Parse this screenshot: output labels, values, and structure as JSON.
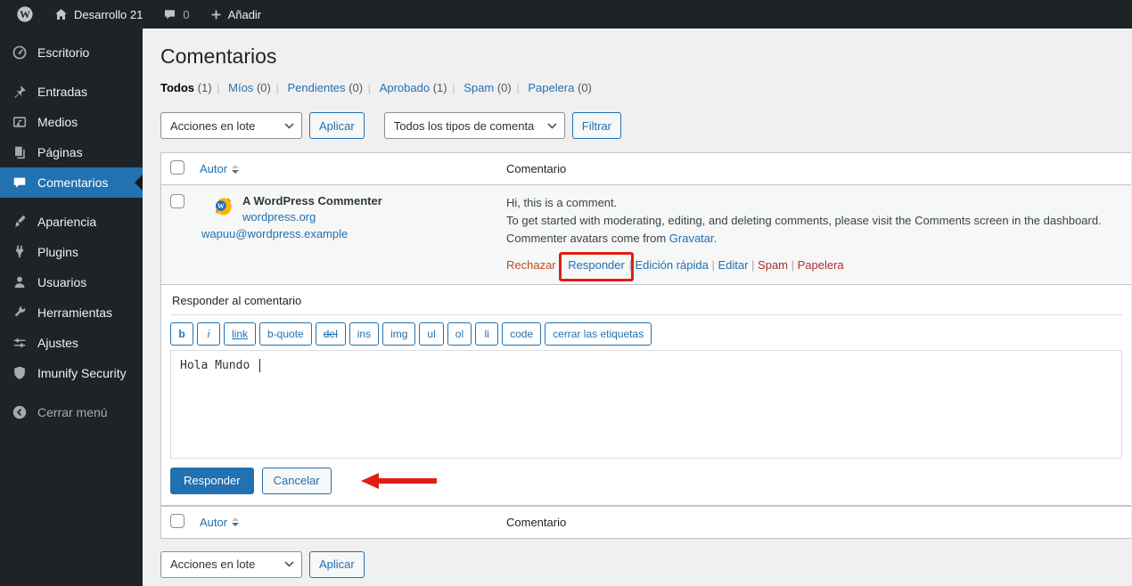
{
  "admin_bar": {
    "site_name": "Desarrollo 21",
    "comments_count": "0",
    "add_new_label": "Añadir"
  },
  "sidebar": {
    "items": [
      {
        "label": "Escritorio"
      },
      {
        "label": "Entradas"
      },
      {
        "label": "Medios"
      },
      {
        "label": "Páginas"
      },
      {
        "label": "Comentarios"
      },
      {
        "label": "Apariencia"
      },
      {
        "label": "Plugins"
      },
      {
        "label": "Usuarios"
      },
      {
        "label": "Herramientas"
      },
      {
        "label": "Ajustes"
      },
      {
        "label": "Imunify Security"
      }
    ],
    "collapse_label": "Cerrar menú"
  },
  "page": {
    "title": "Comentarios"
  },
  "filters": [
    {
      "label": "Todos",
      "count": "(1)"
    },
    {
      "label": "Míos",
      "count": "(0)"
    },
    {
      "label": "Pendientes",
      "count": "(0)"
    },
    {
      "label": "Aprobado",
      "count": "(1)"
    },
    {
      "label": "Spam",
      "count": "(0)"
    },
    {
      "label": "Papelera",
      "count": "(0)"
    }
  ],
  "toolbar_top": {
    "bulk_action_value": "Acciones en lote",
    "apply_label": "Aplicar",
    "comment_type_value": "Todos los tipos de comenta",
    "filter_label": "Filtrar"
  },
  "table": {
    "author_header": "Autor",
    "comment_header": "Comentario"
  },
  "comment": {
    "author_name": "A WordPress Commenter",
    "author_url": "wordpress.org",
    "author_email": "wapuu@wordpress.example",
    "line1": "Hi, this is a comment.",
    "line2": "To get started with moderating, editing, and deleting comments, please visit the Comments screen in the dashboard.",
    "line3_prefix": "Commenter avatars come from ",
    "line3_link": "Gravatar",
    "line3_suffix": ".",
    "actions": [
      {
        "label": "Rechazar"
      },
      {
        "label": "Responder"
      },
      {
        "label": "Edición rápida"
      },
      {
        "label": "Editar"
      },
      {
        "label": "Spam"
      },
      {
        "label": "Papelera"
      }
    ]
  },
  "reply_form": {
    "title": "Responder al comentario",
    "quicktags": [
      "b",
      "i",
      "link",
      "b-quote",
      "del",
      "ins",
      "img",
      "ul",
      "ol",
      "li",
      "code",
      "cerrar las etiquetas"
    ],
    "textarea_value": "Hola Mundo ",
    "submit_label": "Responder",
    "cancel_label": "Cancelar"
  },
  "toolbar_bottom": {
    "bulk_action_value": "Acciones en lote",
    "apply_label": "Aplicar"
  },
  "colors": {
    "accent": "#2271b1",
    "admin_bar_bg": "#1d2327",
    "content_bg": "#f0f0f1",
    "annotation_red": "#e21d12",
    "danger_red": "#b32d2e",
    "unapprove_orange": "#bf4a1e",
    "row_stripe": "#f6f7f7"
  }
}
